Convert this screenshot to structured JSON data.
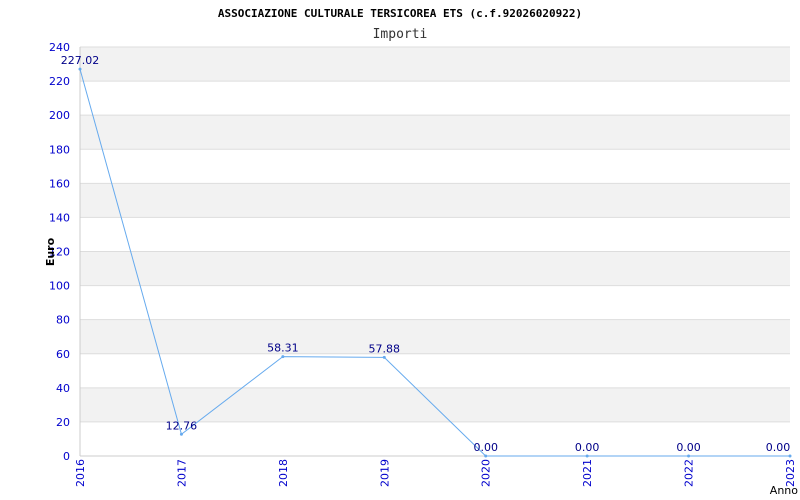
{
  "chart_data": {
    "type": "line",
    "title": "ASSOCIAZIONE CULTURALE TERSICOREA ETS (c.f.92026020922)",
    "subtitle": "Importi",
    "xlabel": "Anno",
    "ylabel": "Euro",
    "categories": [
      "2016",
      "2017",
      "2018",
      "2019",
      "2020",
      "2021",
      "2022",
      "2023"
    ],
    "series": [
      {
        "values": [
          227.02,
          12.76,
          58.31,
          57.88,
          0.0,
          0.0,
          0.0,
          0.0
        ],
        "labels": [
          "227.02",
          "12.76",
          "58.31",
          "57.88",
          "0.00",
          "0.00",
          "0.00",
          "0.00"
        ]
      }
    ],
    "ylim": [
      0,
      240
    ],
    "yticks": [
      "0",
      "20",
      "40",
      "60",
      "80",
      "100",
      "120",
      "140",
      "160",
      "180",
      "200",
      "220",
      "240"
    ],
    "grid": true,
    "colors": {
      "line": "#66aaee",
      "band": "#f2f2f2",
      "grid": "#dddddd",
      "tick_text": "#0000cc",
      "data_label": "#000088",
      "title_text": "#000000",
      "subtitle_text": "#333333"
    }
  }
}
